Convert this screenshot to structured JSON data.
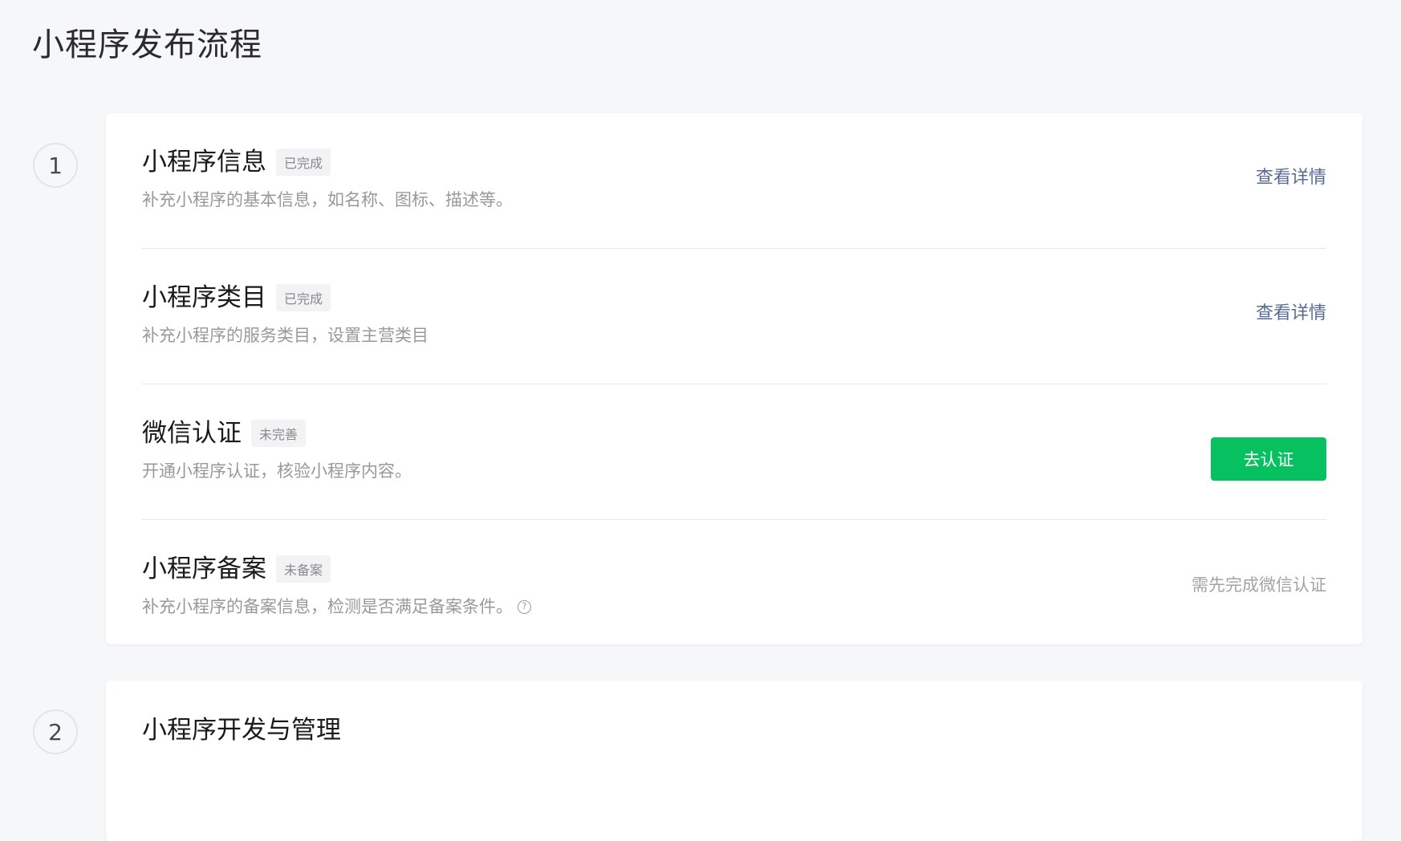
{
  "page": {
    "title": "小程序发布流程"
  },
  "steps": [
    {
      "number": "1",
      "items": [
        {
          "title": "小程序信息",
          "status": "已完成",
          "description": "补充小程序的基本信息，如名称、图标、描述等。",
          "action": "查看详情"
        },
        {
          "title": "小程序类目",
          "status": "已完成",
          "description": "补充小程序的服务类目，设置主营类目",
          "action": "查看详情"
        },
        {
          "title": "微信认证",
          "status": "未完善",
          "description": "开通小程序认证，核验小程序内容。",
          "action": "去认证"
        },
        {
          "title": "小程序备案",
          "status": "未备案",
          "description": "补充小程序的备案信息，检测是否满足备案条件。",
          "help_icon": "question-circle-icon",
          "action": "需先完成微信认证"
        }
      ]
    },
    {
      "number": "2",
      "title": "小程序开发与管理"
    }
  ],
  "colors": {
    "background": "#f6f7f9",
    "card": "#ffffff",
    "link": "#576b95",
    "primary": "#07c160",
    "muted": "#999999"
  }
}
